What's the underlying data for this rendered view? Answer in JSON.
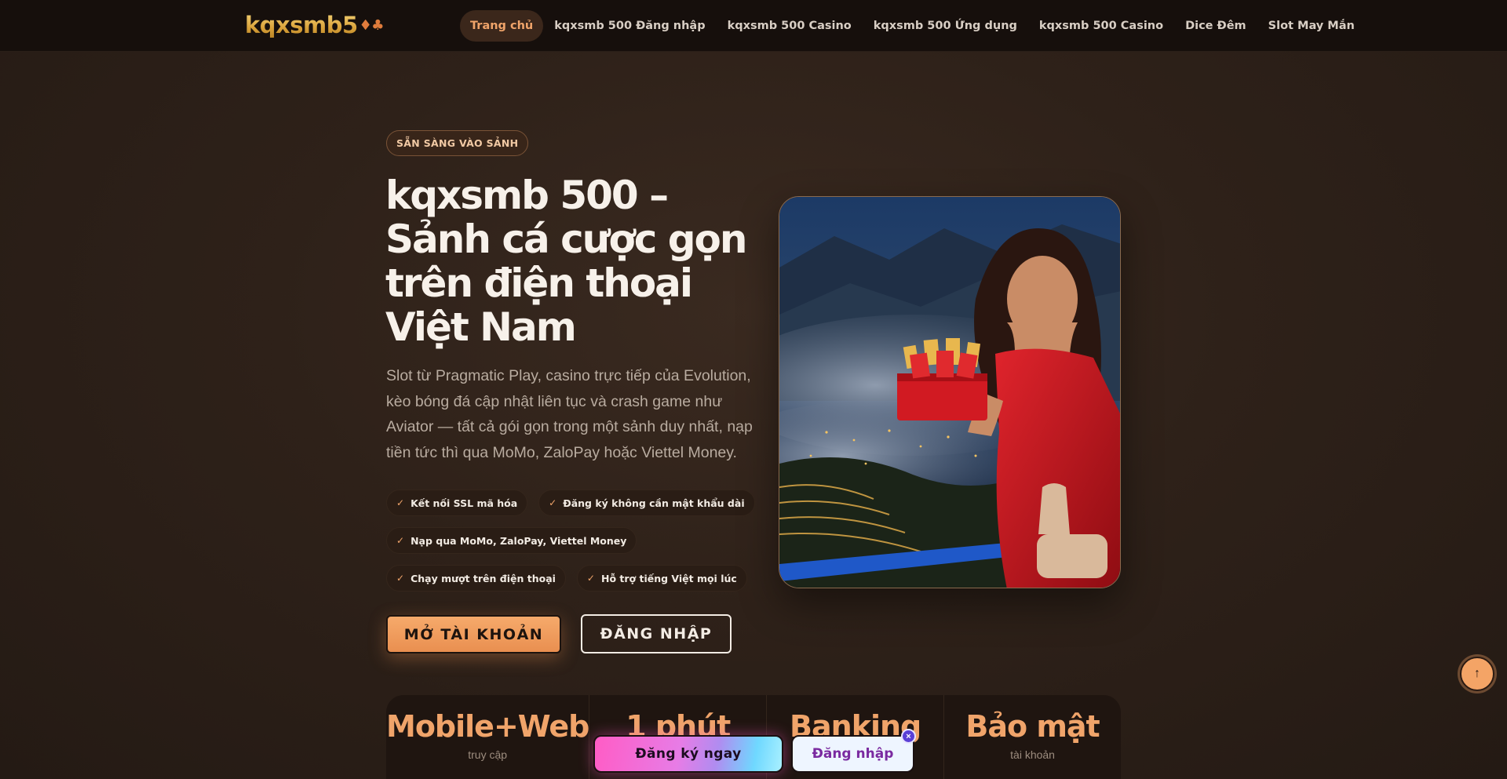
{
  "brand": {
    "logo_text": "kqxsmb5",
    "logo_suits": "♦♣"
  },
  "nav": {
    "items": [
      {
        "label": "Trang chủ",
        "active": true
      },
      {
        "label": "kqxsmb 500 Đăng nhập"
      },
      {
        "label": "kqxsmb 500 Casino"
      },
      {
        "label": "kqxsmb 500 Ứng dụng"
      },
      {
        "label": "kqxsmb 500 Casino"
      },
      {
        "label": "Dice Đêm"
      },
      {
        "label": "Slot May Mắn"
      }
    ]
  },
  "hero": {
    "badge": "SẴN SÀNG VÀO SẢNH",
    "title": "kqxsmb 500 – Sảnh cá cược gọn trên điện thoại Việt Nam",
    "description": "Slot từ Pragmatic Play, casino trực tiếp của Evolution, kèo bóng đá cập nhật liên tục và crash game như Aviator — tất cả gói gọn trong một sảnh duy nhất, nạp tiền tức thì qua MoMo, ZaloPay hoặc Viettel Money.",
    "features": [
      "Kết nối SSL mã hóa",
      "Đăng ký không cần mật khẩu dài",
      "Nạp qua MoMo, ZaloPay, Viettel Money",
      "Chạy mượt trên điện thoại",
      "Hỗ trợ tiếng Việt mọi lúc"
    ],
    "primary_cta": "MỞ TÀI KHOẢN",
    "secondary_cta": "ĐĂNG NHẬP"
  },
  "stats": [
    {
      "value": "Mobile+Web",
      "label": "truy cập"
    },
    {
      "value": "1 phút",
      "label": ""
    },
    {
      "value": "Banking",
      "label": ""
    },
    {
      "value": "Bảo mật",
      "label": "tài khoản"
    }
  ],
  "floating_bar": {
    "register": "Đăng ký ngay",
    "login": "Đăng nhập",
    "close": "×"
  },
  "scroll_top": "↑",
  "colors": {
    "accent": "#f0a46a",
    "background": "#2e2119",
    "header": "#160f0c"
  }
}
